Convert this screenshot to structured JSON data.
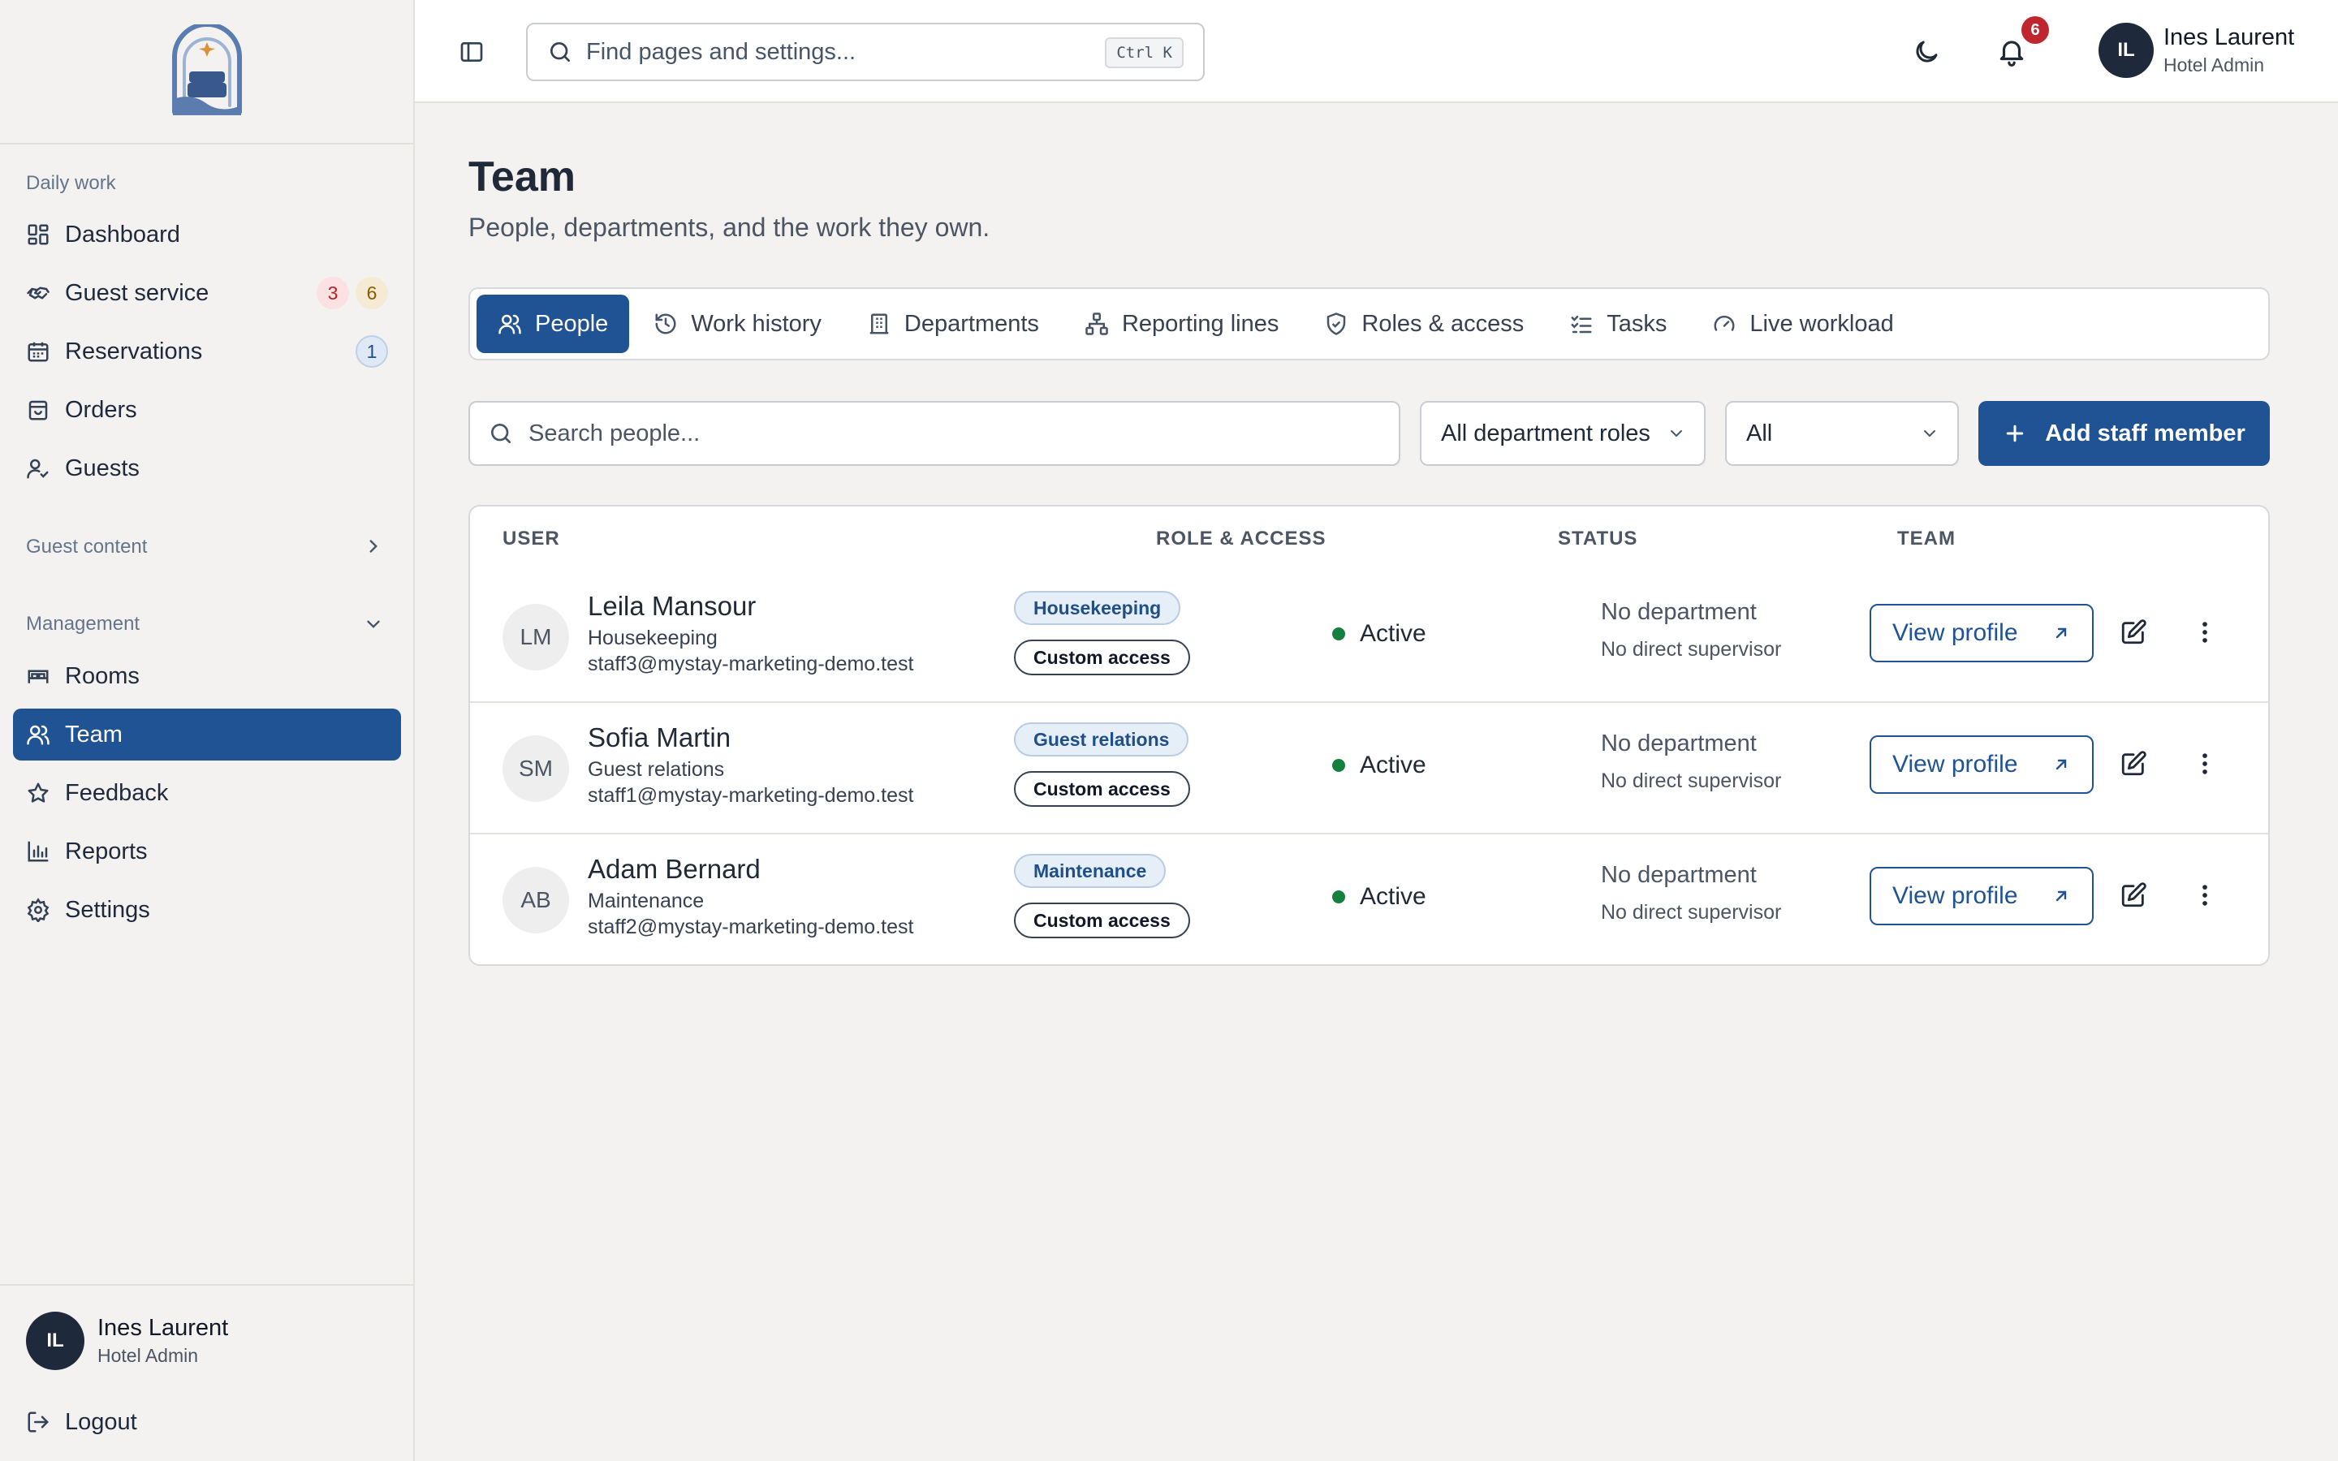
{
  "sidebar": {
    "sections": {
      "daily_work": "Daily work",
      "guest_content": "Guest content",
      "management": "Management"
    },
    "items": [
      {
        "label": "Dashboard",
        "icon": "dashboard-icon"
      },
      {
        "label": "Guest service",
        "icon": "handshake-icon",
        "badges": [
          "3",
          "6"
        ]
      },
      {
        "label": "Reservations",
        "icon": "calendar-icon",
        "badges": [
          "1"
        ]
      },
      {
        "label": "Orders",
        "icon": "shopping-bag-icon"
      },
      {
        "label": "Guests",
        "icon": "user-check-icon"
      },
      {
        "label": "Rooms",
        "icon": "bed-icon"
      },
      {
        "label": "Team",
        "icon": "users-icon",
        "active": true
      },
      {
        "label": "Feedback",
        "icon": "star-icon"
      },
      {
        "label": "Reports",
        "icon": "bar-chart-icon"
      },
      {
        "label": "Settings",
        "icon": "gear-icon"
      }
    ],
    "user": {
      "initials": "IL",
      "name": "Ines Laurent",
      "role": "Hotel Admin"
    },
    "logout": "Logout"
  },
  "topbar": {
    "search_placeholder": "Find pages and settings...",
    "shortcut": "Ctrl K",
    "notification_count": "6",
    "user": {
      "initials": "IL",
      "name": "Ines Laurent",
      "role": "Hotel Admin"
    }
  },
  "page": {
    "title": "Team",
    "subtitle": "People, departments, and the work they own."
  },
  "tabs": [
    {
      "label": "People",
      "icon": "users-icon",
      "active": true
    },
    {
      "label": "Work history",
      "icon": "history-icon"
    },
    {
      "label": "Departments",
      "icon": "building-icon"
    },
    {
      "label": "Reporting lines",
      "icon": "hierarchy-icon"
    },
    {
      "label": "Roles & access",
      "icon": "shield-check-icon"
    },
    {
      "label": "Tasks",
      "icon": "list-checks-icon"
    },
    {
      "label": "Live workload",
      "icon": "gauge-icon"
    }
  ],
  "toolbar": {
    "search_placeholder": "Search people...",
    "department_filter": "All department roles",
    "status_filter": "All",
    "add_button": "Add staff member"
  },
  "table": {
    "headers": {
      "user": "USER",
      "role": "ROLE & ACCESS",
      "status": "STATUS",
      "team": "TEAM"
    },
    "view_label": "View profile",
    "rows": [
      {
        "initials": "LM",
        "name": "Leila Mansour",
        "dept": "Housekeeping",
        "email": "staff3@mystay-marketing-demo.test",
        "role_tag": "Housekeeping",
        "access": "Custom access",
        "status": "Active",
        "department": "No department",
        "supervisor": "No direct supervisor"
      },
      {
        "initials": "SM",
        "name": "Sofia Martin",
        "dept": "Guest relations",
        "email": "staff1@mystay-marketing-demo.test",
        "role_tag": "Guest relations",
        "access": "Custom access",
        "status": "Active",
        "department": "No department",
        "supervisor": "No direct supervisor"
      },
      {
        "initials": "AB",
        "name": "Adam Bernard",
        "dept": "Maintenance",
        "email": "staff2@mystay-marketing-demo.test",
        "role_tag": "Maintenance",
        "access": "Custom access",
        "status": "Active",
        "department": "No department",
        "supervisor": "No direct supervisor"
      }
    ]
  },
  "colors": {
    "primary": "#1f5394",
    "status_active": "#15803d",
    "badge_red": "#b42323",
    "notification": "#c0262d"
  }
}
